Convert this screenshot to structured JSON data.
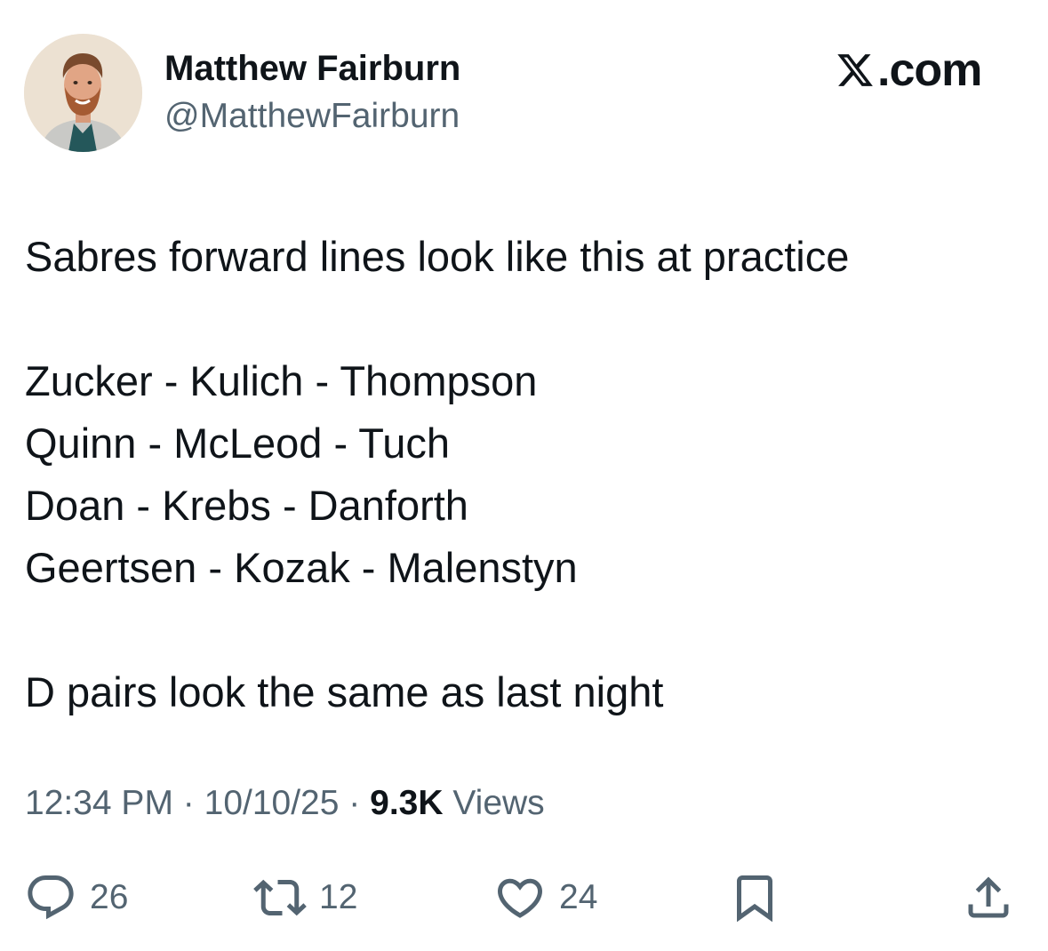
{
  "author": {
    "display_name": "Matthew Fairburn",
    "handle": "@MatthewFairburn",
    "avatar_icon": "profile-photo"
  },
  "brand": {
    "logo_icon": "x-logo-icon",
    "suffix": ".com"
  },
  "tweet": {
    "lines": {
      "intro": "Sabres forward lines look like this at practice",
      "line1": "Zucker - Kulich - Thompson",
      "line2": "Quinn - McLeod - Tuch",
      "line3": "Doan - Krebs - Danforth",
      "line4": "Geertsen - Kozak - Malenstyn",
      "outro": "D pairs look the same as last night"
    }
  },
  "meta": {
    "time": "12:34 PM",
    "sep": "·",
    "date": "10/10/25",
    "views_count": "9.3K",
    "views_label": "Views"
  },
  "actions": {
    "reply": {
      "icon": "reply-icon",
      "count": "26"
    },
    "repost": {
      "icon": "repost-icon",
      "count": "12"
    },
    "like": {
      "icon": "heart-icon",
      "count": "24"
    },
    "bookmark": {
      "icon": "bookmark-icon"
    },
    "share": {
      "icon": "share-icon"
    }
  },
  "colors": {
    "text_primary": "#0f1419",
    "text_secondary": "#536471",
    "background": "#ffffff"
  }
}
